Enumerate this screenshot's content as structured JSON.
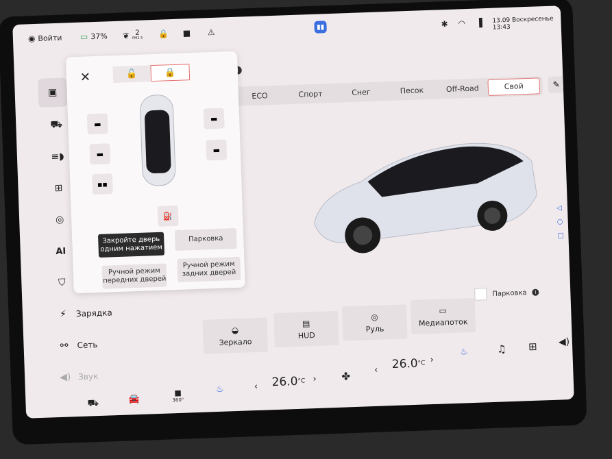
{
  "status_bar": {
    "login_label": "Войти",
    "battery_pct": "37%",
    "pm_value": "2",
    "pm_unit": "PM2.5",
    "datetime": "13.09 Воскресенье 13:43",
    "icons": [
      "user-icon",
      "battery-icon",
      "leaf-icon",
      "lock-icon",
      "camera-icon",
      "alert-icon",
      "app-logo-icon",
      "bluetooth-icon",
      "wifi-icon",
      "signal-icon"
    ]
  },
  "sidebar": {
    "items": [
      {
        "icon": "car-door-icon",
        "label": ""
      },
      {
        "icon": "car-icon",
        "label": ""
      },
      {
        "icon": "headlight-icon",
        "label": ""
      },
      {
        "icon": "chassis-icon",
        "label": ""
      },
      {
        "icon": "steering-icon",
        "label": ""
      },
      {
        "icon": "ai-icon",
        "label": "AI"
      },
      {
        "icon": "shield-icon",
        "label": ""
      },
      {
        "icon": "charging-icon",
        "label": "Зарядка"
      },
      {
        "icon": "network-icon",
        "label": "Сеть"
      },
      {
        "icon": "sound-icon",
        "label": "Звук"
      }
    ]
  },
  "door_panel": {
    "close_symbol": "✕",
    "unlock_icon": "🔓",
    "lock_icon": "🔒",
    "buttons": {
      "close_one_touch": "Закройте дверь одним нажатием",
      "parking": "Парковка",
      "manual_front": "Ручной режим передних дверей",
      "manual_rear": "Ручной режим задних дверей"
    }
  },
  "drive_modes": {
    "items": [
      "ECO",
      "Спорт",
      "Снег",
      "Песок",
      "Off-Road",
      "Свой"
    ],
    "selected": "Свой"
  },
  "parking_checkbox": {
    "label": "Парковка"
  },
  "tiles": [
    {
      "icon": "mirror-icon",
      "label": "Зеркало"
    },
    {
      "icon": "hud-icon",
      "label": "HUD"
    },
    {
      "icon": "steering-icon",
      "label": "Руль"
    },
    {
      "icon": "media-icon",
      "label": "Медиапоток"
    }
  ],
  "bottom_bar": {
    "temp_left": "26.0",
    "temp_right": "26.0",
    "temp_unit": "°C",
    "camera_label": "360°",
    "fan_label": "",
    "chevron_left": "‹",
    "chevron_right": "›"
  },
  "nav_right": [
    "back-icon",
    "home-icon",
    "recent-icon"
  ],
  "colors": {
    "screen_bg": "#f1eaed",
    "accent_border": "#e57373",
    "dark_button": "#2b2b2b"
  }
}
